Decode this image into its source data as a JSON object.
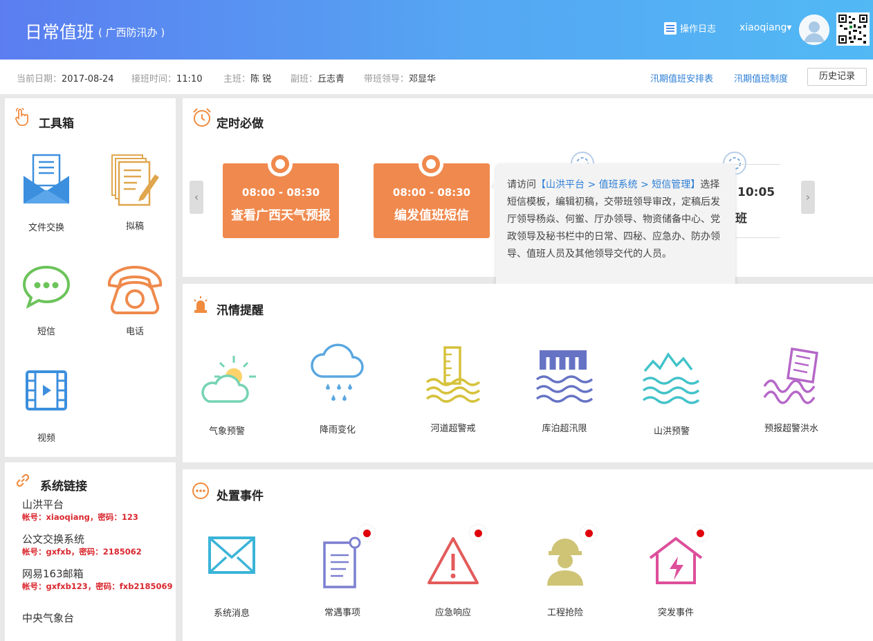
{
  "header": {
    "title": "日常值班",
    "subtitle": "( 广西防汛办 )",
    "oplog": "操作日志",
    "user": "xiaoqiang▾"
  },
  "info": {
    "date_label": "当前日期：",
    "date": "2017-08-24",
    "shift_label": "接班时间：",
    "shift": "11:10",
    "main_label": "主班：",
    "main": "陈 锐",
    "deputy_label": "副班：",
    "deputy": "丘志青",
    "leader_label": "带班领导：",
    "leader": "邓显华",
    "links": [
      "汛期值班安排表",
      "汛期值班制度"
    ],
    "history": "历史记录"
  },
  "toolbox": {
    "title": "工具箱",
    "items": [
      "文件交换",
      "拟稿",
      "短信",
      "电话",
      "视频"
    ]
  },
  "links": {
    "title": "系统链接",
    "items": [
      {
        "name": "山洪平台",
        "account": "帐号：xiaoqiang，密码：123"
      },
      {
        "name": "公文交换系统",
        "account": "帐号：gxfxb，密码：2185062"
      },
      {
        "name": "网易163邮箱",
        "account": "帐号：gxfxb123，密码：fxb2185069"
      },
      {
        "name": "中央气象台",
        "account": ""
      }
    ]
  },
  "scheduled": {
    "title": "定时必做",
    "cards": [
      {
        "time": "08:00 - 08:30",
        "name": "查看广西天气预报"
      },
      {
        "time": "08:00 - 08:30",
        "name": "编发值班短信"
      },
      {
        "time": "10:05",
        "name": "班"
      }
    ],
    "tooltip": {
      "prefix": "请访问",
      "path": "【山洪平台 > 值班系统 > 短信管理】",
      "body": "选择短信模板，编辑初稿，交带班领导审改，定稿后发厅领导杨焱、何鲎、厅办领导、物资储备中心、党政领导及秘书栏中的日常、四秘、应急办、防办领导、值班人员及其他领导交代的人员。"
    }
  },
  "flood": {
    "title": "汛情提醒",
    "items": [
      "气象预警",
      "降雨变化",
      "河道超警戒",
      "库泊超汛限",
      "山洪预警",
      "预报超警洪水"
    ]
  },
  "events": {
    "title": "处置事件",
    "items": [
      "系统消息",
      "常遇事项",
      "应急响应",
      "工程抢险",
      "突发事件"
    ]
  }
}
